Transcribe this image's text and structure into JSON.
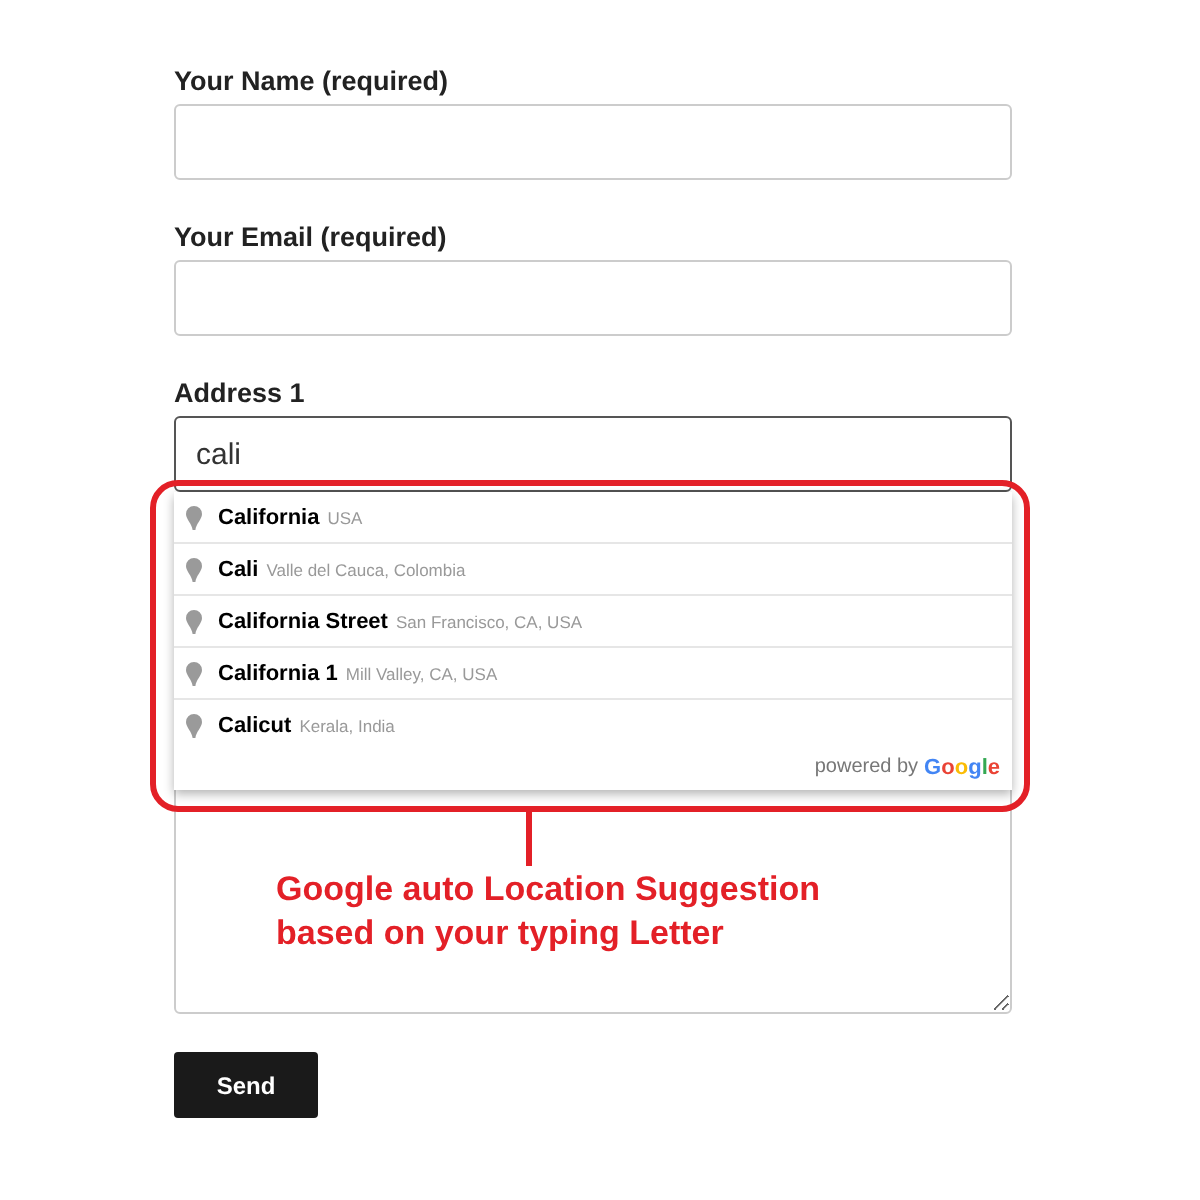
{
  "fields": [
    {
      "label": "Your Name (required)",
      "focused": false
    },
    {
      "label": "Your Email (required)",
      "focused": false
    },
    {
      "label": "Address 1",
      "value": "cali",
      "focused": true
    }
  ],
  "suggestions": [
    {
      "main": "California",
      "secondary": "USA"
    },
    {
      "main": "Cali",
      "secondary": "Valle del Cauca, Colombia"
    },
    {
      "main": "California Street",
      "secondary": "San Francisco, CA, USA"
    },
    {
      "main": "California 1",
      "secondary": "Mill Valley, CA, USA"
    },
    {
      "main": "Calicut",
      "secondary": "Kerala, India"
    }
  ],
  "attribution": {
    "prefix": "powered by",
    "brand": "Google"
  },
  "annotation": {
    "lines": [
      "Google auto Location Suggestion",
      "based on your typing Letter"
    ]
  },
  "submit": "Send"
}
